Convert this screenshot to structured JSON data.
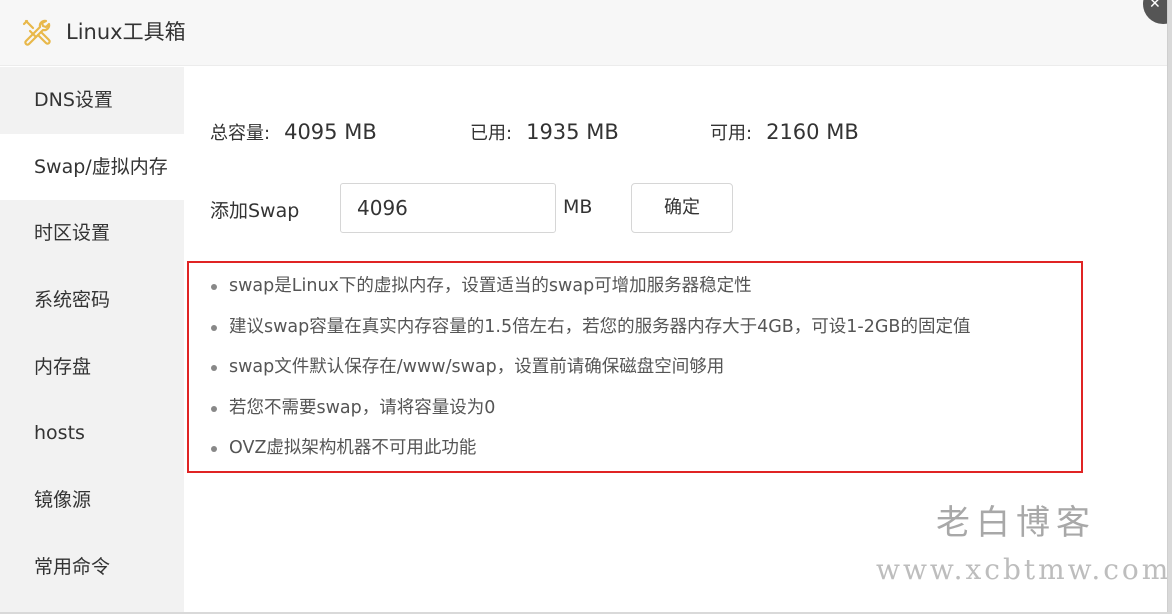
{
  "window": {
    "title": "Linux工具箱",
    "close_symbol": "✕",
    "title_icon": "tools-icon",
    "accent_color": "#e8b84a"
  },
  "sidebar": {
    "items": [
      {
        "label": "DNS设置"
      },
      {
        "label": "Swap/虚拟内存",
        "active": true
      },
      {
        "label": "时区设置"
      },
      {
        "label": "系统密码"
      },
      {
        "label": "内存盘"
      },
      {
        "label": "hosts"
      },
      {
        "label": "镜像源"
      },
      {
        "label": "常用命令"
      }
    ]
  },
  "stats": {
    "total_label": "总容量:",
    "total_value": "4095 MB",
    "used_label": "已用:",
    "used_value": "1935 MB",
    "free_label": "可用:",
    "free_value": "2160 MB"
  },
  "swap_form": {
    "label": "添加Swap",
    "value": "4096",
    "unit": "MB",
    "confirm_label": "确定"
  },
  "notes": {
    "border_color": "#e02424",
    "items": [
      "swap是Linux下的虚拟内存，设置适当的swap可增加服务器稳定性",
      "建议swap容量在真实内存容量的1.5倍左右，若您的服务器内存大于4GB，可设1-2GB的固定值",
      "swap文件默认保存在/www/swap，设置前请确保磁盘空间够用",
      "若您不需要swap，请将容量设为0",
      "OVZ虚拟架构机器不可用此功能"
    ]
  },
  "watermark": {
    "line1": "老白博客",
    "line2": "www.xcbtmw.com"
  }
}
